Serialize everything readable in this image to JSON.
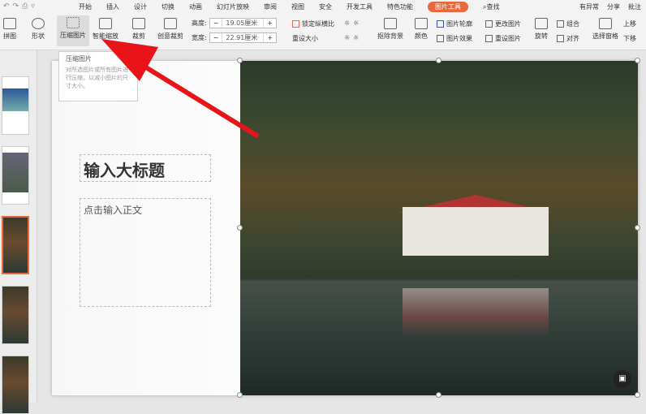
{
  "tabs": [
    "开始",
    "插入",
    "设计",
    "切换",
    "动画",
    "幻灯片放映",
    "审阅",
    "视图",
    "安全",
    "开发工具",
    "特色功能",
    "图片工具"
  ],
  "search": "查找",
  "right": {
    "status": "有异常",
    "share": "分享",
    "comment": "批注"
  },
  "ribbon": {
    "stitch": "拼图",
    "shape": "形状",
    "compress": "压缩图片",
    "smart_zoom": "智能缩放",
    "crop": "裁剪",
    "creative_crop": "创意裁剪",
    "height_label": "高度:",
    "height_value": "19.05厘米",
    "width_label": "宽度:",
    "width_value": "22.91厘米",
    "lock_ratio": "锁定纵横比",
    "reset_size": "重设大小",
    "remove_bg": "抠除背景",
    "color": "颜色",
    "outline": "图片轮廓",
    "effects": "图片效果",
    "change": "更改图片",
    "reset_pic": "重设图片",
    "rotate": "旋转",
    "group": "组合",
    "align": "对齐",
    "selection_pane": "选择窗格",
    "up": "上移",
    "down": "下移"
  },
  "tooltip": {
    "title": "压缩图片",
    "text": "对所选图片或所有图片进行压缩，以减小图片的尺寸大小。"
  },
  "slide": {
    "title": "输入大标题",
    "body": "点击输入正文"
  },
  "colors": {
    "accent": "#e8693d",
    "arrow": "#e8141a"
  }
}
